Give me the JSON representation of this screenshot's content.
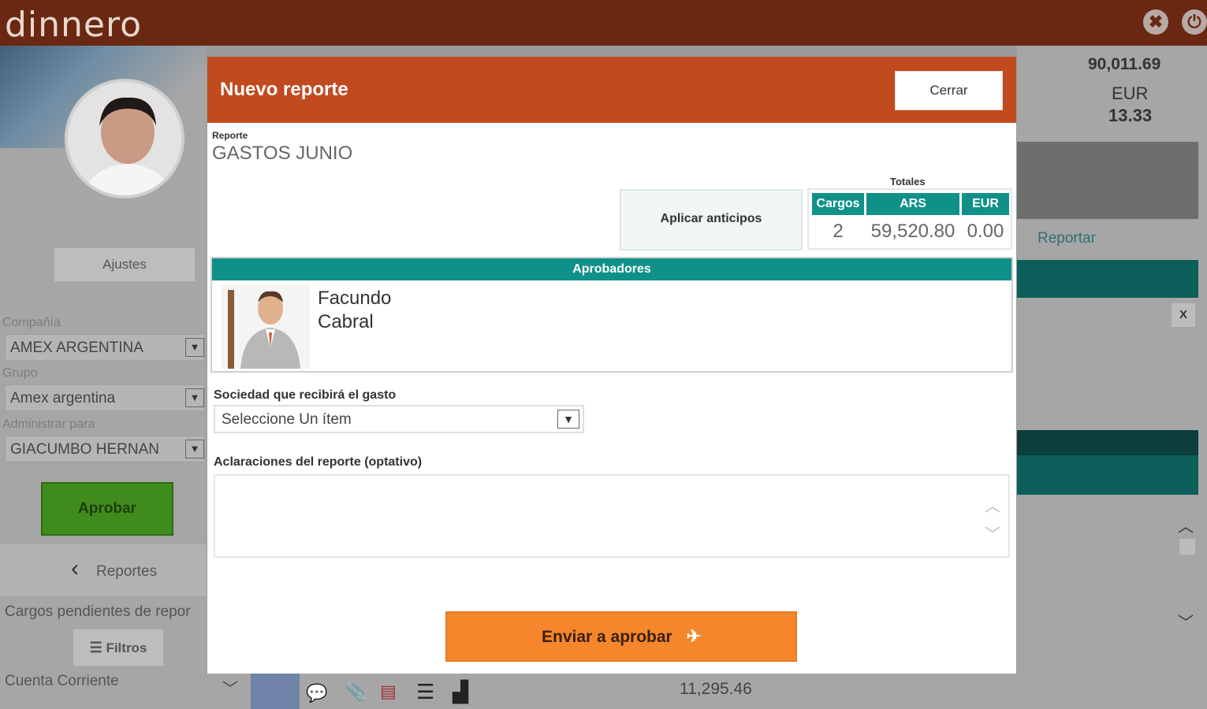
{
  "app": {
    "logo": "dinnero"
  },
  "topbar": {
    "settings_icon": "tools-icon",
    "power_icon": "power-icon"
  },
  "sidebar": {
    "settings_label": "Ajustes",
    "company_label": "Compañía",
    "company_value": "AMEX ARGENTINA",
    "group_label": "Grupo",
    "group_value": "Amex argentina",
    "manage_label": "Administrar para",
    "manage_value": "GIACUMBO HERNAN",
    "approve_label": "Aprobar",
    "reports_nav_label": "Reportes",
    "pending_label": "Cargos pendientes de repor",
    "filters_label": "Filtros",
    "account_label": "Cuenta Corriente"
  },
  "right_panel": {
    "ars_amount": "90,011.69",
    "eur_label": "EUR",
    "eur_amount": "13.33",
    "report_link": "Reportar",
    "close_x": "X"
  },
  "bottom": {
    "amount": "11,295.46"
  },
  "modal": {
    "title": "Nuevo reporte",
    "close_label": "Cerrar",
    "report_label": "Reporte",
    "report_name": "GASTOS JUNIO",
    "apply_advances_label": "Aplicar anticipos",
    "totals_label": "Totales",
    "totals": {
      "headers": [
        "Cargos",
        "ARS",
        "EUR"
      ],
      "values": [
        "2",
        "59,520.80",
        "0.00"
      ]
    },
    "approvers_header": "Aprobadores",
    "approver": {
      "first": "Facundo",
      "last": "Cabral"
    },
    "company_field_label": "Sociedad que recibirá el gasto",
    "company_select_value": "Seleccione Un ítem",
    "notes_label": "Aclaraciones del reporte (optativo)",
    "notes_value": "",
    "send_label": "Enviar a aprobar"
  }
}
